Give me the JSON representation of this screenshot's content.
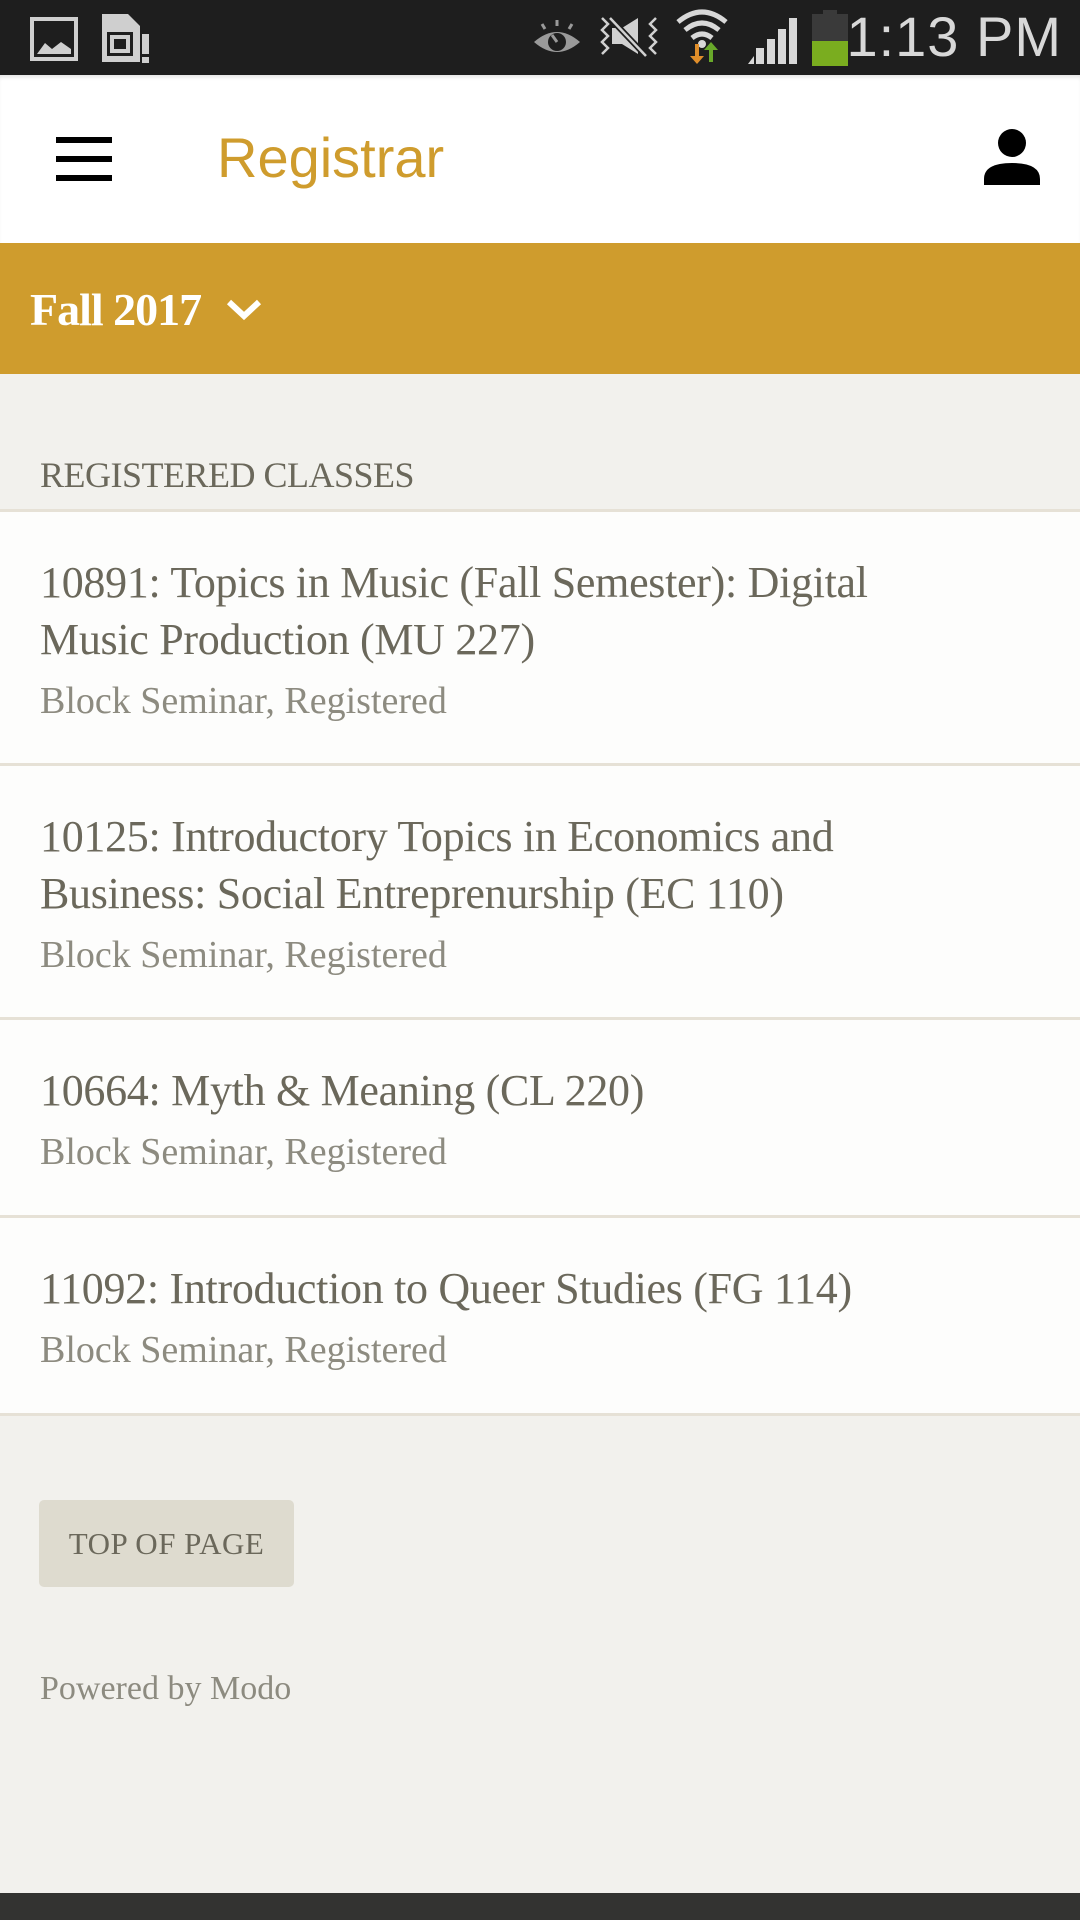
{
  "status_bar": {
    "time": "1:13 PM",
    "left_icons": [
      "gallery-icon",
      "sd-card-warning-icon"
    ],
    "right_icons": [
      "eye-icon",
      "mute-vibrate-icon",
      "wifi-data-icon",
      "signal-icon",
      "battery-icon"
    ],
    "battery_level_percent": 50,
    "colors": {
      "battery": "#7aad1f",
      "download_arrow": "#e08e2a",
      "upload_arrow": "#69a92a"
    }
  },
  "header": {
    "title": "Registrar",
    "menu_icon": "hamburger-menu-icon",
    "profile_icon": "person-icon"
  },
  "term_selector": {
    "selected": "Fall 2017",
    "icon": "chevron-down-icon"
  },
  "section": {
    "heading": "REGISTERED CLASSES",
    "classes": [
      {
        "title": "10891: Topics in Music (Fall Semester): Digital Music Production (MU 227)",
        "line1": "10891: Topics in Music (Fall Semester): Digital",
        "line2": "Music Production (MU 227)",
        "subtitle": "Block Seminar, Registered"
      },
      {
        "title": "10125: Introductory Topics in Economics and Business: Social Entreprenurship (EC 110)",
        "line1": "10125: Introductory Topics in Economics and",
        "line2": "Business: Social Entreprenurship (EC 110)",
        "subtitle": "Block Seminar, Registered"
      },
      {
        "title": "10664: Myth & Meaning (CL 220)",
        "line1": "10664: Myth & Meaning (CL 220)",
        "subtitle": "Block Seminar, Registered"
      },
      {
        "title": "11092: Introduction to Queer Studies (FG 114)",
        "line1": "11092: Introduction to Queer Studies (FG 114)",
        "subtitle": "Block Seminar, Registered"
      }
    ]
  },
  "footer": {
    "top_button": "TOP OF PAGE",
    "powered_by": "Powered by Modo"
  },
  "colors": {
    "accent": "#cf9c2d",
    "background": "#f2f1ed",
    "text_primary": "#6b685b",
    "text_secondary": "#8d8b80",
    "divider": "#e6e1d6"
  }
}
